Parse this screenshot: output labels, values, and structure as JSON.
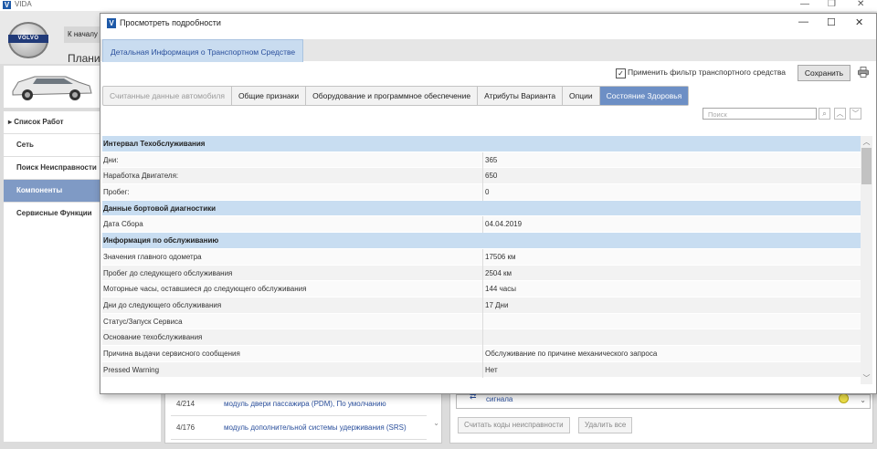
{
  "app": {
    "title": "VIDA",
    "logo_text": "V",
    "brand": "VOLVO",
    "home_tab": "К началу",
    "plan_tab": "Плани"
  },
  "left_nav": {
    "items": [
      {
        "label": "Список Работ",
        "prefix": "▸"
      },
      {
        "label": "Сеть",
        "prefix": ""
      },
      {
        "label": "Поиск Неисправности",
        "prefix": ""
      },
      {
        "label": "Компоненты",
        "prefix": ""
      },
      {
        "label": "Сервисные Функции",
        "prefix": ""
      }
    ],
    "active_index": 3
  },
  "bottom_list": {
    "rows": [
      {
        "code": "4/214",
        "text": "модуль двери пассажира (PDM), По умолчанию"
      },
      {
        "code": "4/176",
        "text": "модуль дополнительной системы удерживания (SRS)"
      }
    ]
  },
  "bottom_right": {
    "link": "сигнала",
    "read_codes_button": "Считать коды неисправности",
    "delete_all_button": "Удалить все"
  },
  "dialog": {
    "title": "Просмотреть подробности",
    "logo_text": "V",
    "header_tab": "Детальная Информация о Транспортном Средстве",
    "filter_label": "Применить фильтр транспортного средства",
    "filter_checked": "✓",
    "save_button": "Сохранить",
    "search_placeholder": "Поиск",
    "tabs": [
      {
        "label": "Считанные данные автомобиля",
        "state": "disabled"
      },
      {
        "label": "Общие признаки",
        "state": "normal"
      },
      {
        "label": "Оборудование и программное обеспечение",
        "state": "normal"
      },
      {
        "label": "Атрибуты Варианта",
        "state": "normal"
      },
      {
        "label": "Опции",
        "state": "normal"
      },
      {
        "label": "Состояние Здоровья",
        "state": "active"
      }
    ],
    "rows": [
      {
        "type": "section",
        "label": "Интервал Техобслуживания",
        "value": ""
      },
      {
        "type": "data",
        "label": "Дни:",
        "value": "365"
      },
      {
        "type": "data",
        "label": "Наработка Двигателя:",
        "value": "650"
      },
      {
        "type": "data",
        "label": "Пробег:",
        "value": "0"
      },
      {
        "type": "section",
        "label": "Данные бортовой диагностики",
        "value": ""
      },
      {
        "type": "data",
        "label": "Дата Сбора",
        "value": "04.04.2019"
      },
      {
        "type": "section",
        "label": "Информация по обслуживанию",
        "value": ""
      },
      {
        "type": "data",
        "label": "Значения главного одометра",
        "value": "17506 км"
      },
      {
        "type": "data",
        "label": "Пробег до следующего обслуживания",
        "value": "2504 км"
      },
      {
        "type": "data",
        "label": "Моторные часы, оставшиеся до следующего обслуживания",
        "value": "144 часы"
      },
      {
        "type": "data",
        "label": "Дни до следующего обслуживания",
        "value": "17 Дни"
      },
      {
        "type": "data",
        "label": "Статус/Запуск Сервиса",
        "value": ""
      },
      {
        "type": "data",
        "label": "Основание техобслуживания",
        "value": ""
      },
      {
        "type": "data",
        "label": "Причина выдачи сервисного сообщения",
        "value": "Обслуживание по причине механического запроса"
      },
      {
        "type": "data",
        "label": "Pressed Warning",
        "value": "Нет"
      }
    ]
  },
  "colors": {
    "accent": "#6d8fc5",
    "section_bg": "#c8ddf1",
    "link": "#2a4f9c",
    "nav_active": "#7f9ac5"
  }
}
